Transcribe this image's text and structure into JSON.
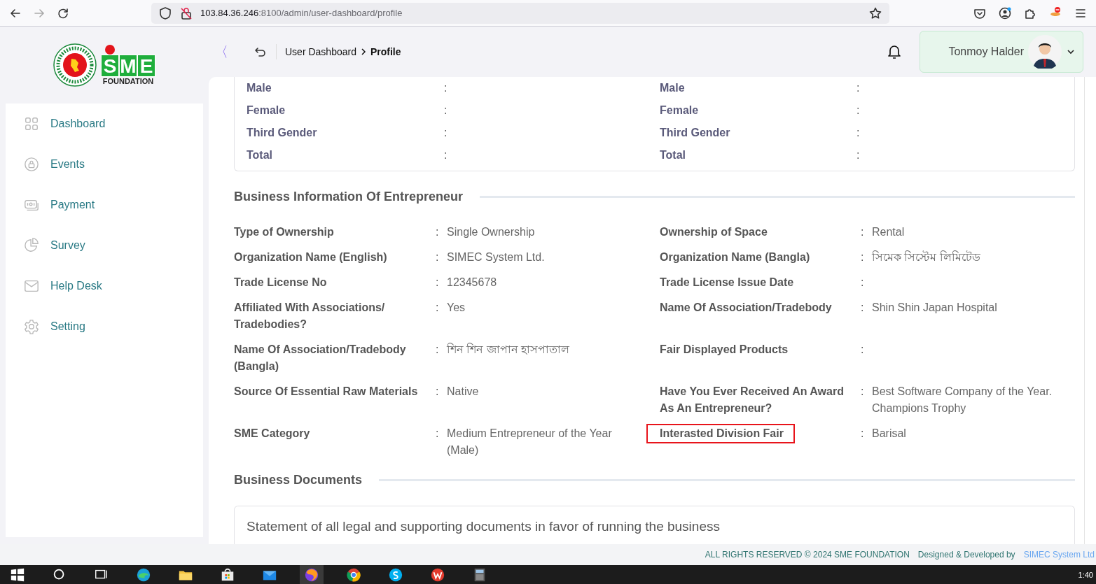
{
  "browser": {
    "url_host": "103.84.36.246",
    "url_rest": ":8100/admin/user-dashboard/profile"
  },
  "logo": {
    "letters": [
      "S",
      "M",
      "E"
    ],
    "subtitle": "FOUNDATION"
  },
  "sidebar": {
    "items": [
      {
        "label": "Dashboard",
        "kind": "grid"
      },
      {
        "label": "Events",
        "kind": "lock"
      },
      {
        "label": "Payment",
        "kind": "cash"
      },
      {
        "label": "Survey",
        "kind": "pie"
      },
      {
        "label": "Help Desk",
        "kind": "mail"
      },
      {
        "label": "Setting",
        "kind": "gear"
      }
    ]
  },
  "header": {
    "collapse": "〈",
    "breadcrumb": [
      "User Dashboard",
      "Profile"
    ],
    "user": {
      "name": "Tonmoy Halder"
    }
  },
  "gender_card": {
    "rows": [
      {
        "left": "Male",
        "left_separator": ":",
        "right": "Male",
        "right_separator": ":"
      },
      {
        "left": "Female",
        "left_separator": ":",
        "right": "Female",
        "right_separator": ":"
      },
      {
        "left": "Third Gender",
        "left_separator": ":",
        "right": "Third Gender",
        "right_separator": ":"
      },
      {
        "left": "Total",
        "left_separator": ":",
        "right": "Total",
        "right_separator": ":"
      }
    ]
  },
  "business_info": {
    "title": "Business Information Of Entrepreneur",
    "rows": [
      {
        "left": {
          "label": "Type of Ownership",
          "separator": ":",
          "value": "Single Ownership",
          "highlighted": false
        },
        "right": {
          "label": "Ownership of Space",
          "separator": ":",
          "value": "Rental",
          "highlighted": false
        }
      },
      {
        "left": {
          "label": "Organization Name (English)",
          "separator": ":",
          "value": "SIMEC System Ltd.",
          "highlighted": false
        },
        "right": {
          "label": "Organization Name (Bangla)",
          "separator": ":",
          "value": "সিমেক সিস্টেম লিমিটেড",
          "highlighted": false
        }
      },
      {
        "left": {
          "label": "Trade License No",
          "separator": ":",
          "value": "12345678",
          "highlighted": false
        },
        "right": {
          "label": "Trade License Issue Date",
          "separator": ":",
          "highlighted": false
        }
      },
      {
        "left": {
          "label": "Affiliated With Associations/ Tradebodies?",
          "separator": ":",
          "value": "Yes",
          "highlighted": false
        },
        "right": {
          "label": "Name Of Association/Tradebody",
          "separator": ":",
          "value": "Shin Shin Japan Hospital",
          "highlighted": false
        }
      },
      {
        "left": {
          "label": "Name Of Association/Tradebody (Bangla)",
          "separator": ":",
          "value": "শিন শিন জাপান হাসপাতাল",
          "highlighted": false
        },
        "right": {
          "label": "Fair Displayed Products",
          "separator": ":",
          "highlighted": false
        }
      },
      {
        "left": {
          "label": "Source Of Essential Raw Materials",
          "separator": ":",
          "value": "Native",
          "highlighted": false
        },
        "right": {
          "label": "Have You Ever Received An Award As An Entrepreneur?",
          "separator": ":",
          "value": "Best Software Company of the Year. Champions Trophy",
          "highlighted": false
        }
      },
      {
        "left": {
          "label": "SME Category",
          "separator": ":",
          "value": "Medium Entrepreneur of the Year (Male)",
          "highlighted": false
        },
        "right": {
          "label": "Interasted Division Fair",
          "separator": ":",
          "value": "Barisal",
          "highlighted": true
        }
      }
    ]
  },
  "documents": {
    "title": "Business Documents",
    "description": "Statement of all legal and supporting documents in favor of running the business"
  },
  "footer": {
    "rights": "ALL RIGHTS RESERVED © 2024 SME FOUNDATION",
    "designed_by": "Designed & Developed by",
    "developer_link": "SIMEC System Ltd"
  },
  "taskbar": {
    "apps": [
      {
        "kind": "edge",
        "active": false
      },
      {
        "kind": "folder",
        "active": false
      },
      {
        "kind": "store",
        "active": false
      },
      {
        "kind": "mail",
        "active": false
      },
      {
        "kind": "firefox",
        "active": true
      },
      {
        "kind": "chrome",
        "active": false
      },
      {
        "kind": "skype",
        "active": false
      },
      {
        "kind": "wps",
        "active": false
      },
      {
        "kind": "calculator",
        "active": false
      }
    ],
    "time": "1:40"
  }
}
